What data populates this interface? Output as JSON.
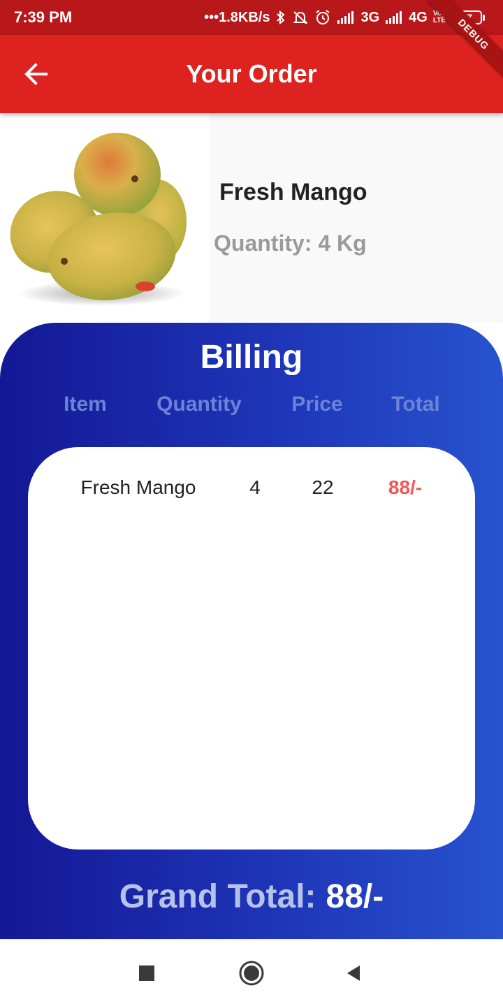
{
  "status_bar": {
    "time": "7:39 PM",
    "network_speed": "•••1.8KB/s",
    "network_3g": "3G",
    "network_4g": "4G",
    "volte_top": "Vo)",
    "volte_bottom": "LTE",
    "battery_level": "17",
    "battery_fraction": 0.17
  },
  "debug_banner": "DEBUG",
  "app_bar": {
    "title": "Your Order",
    "back_icon": "arrow-back-icon"
  },
  "product": {
    "name": "Fresh Mango",
    "quantity": "Quantity: 4 Kg",
    "image_subject": "mango-image"
  },
  "billing": {
    "title": "Billing",
    "headers": [
      "Item",
      "Quantity",
      "Price",
      "Total"
    ],
    "rows": [
      {
        "item": "Fresh Mango",
        "quantity": "4",
        "price": "22",
        "total": "88/-"
      }
    ],
    "grand_total_label": "Grand Total:",
    "grand_total_value": "88/-"
  },
  "nav_bar": {
    "icons": [
      "recent-apps-icon",
      "home-icon",
      "back-icon"
    ]
  },
  "colors": {
    "status_bar": "#b8181a",
    "app_bar": "#dd2220",
    "billing_gradient_start": "#141894",
    "billing_gradient_end": "#2753cf",
    "total_accent": "#f25656"
  }
}
